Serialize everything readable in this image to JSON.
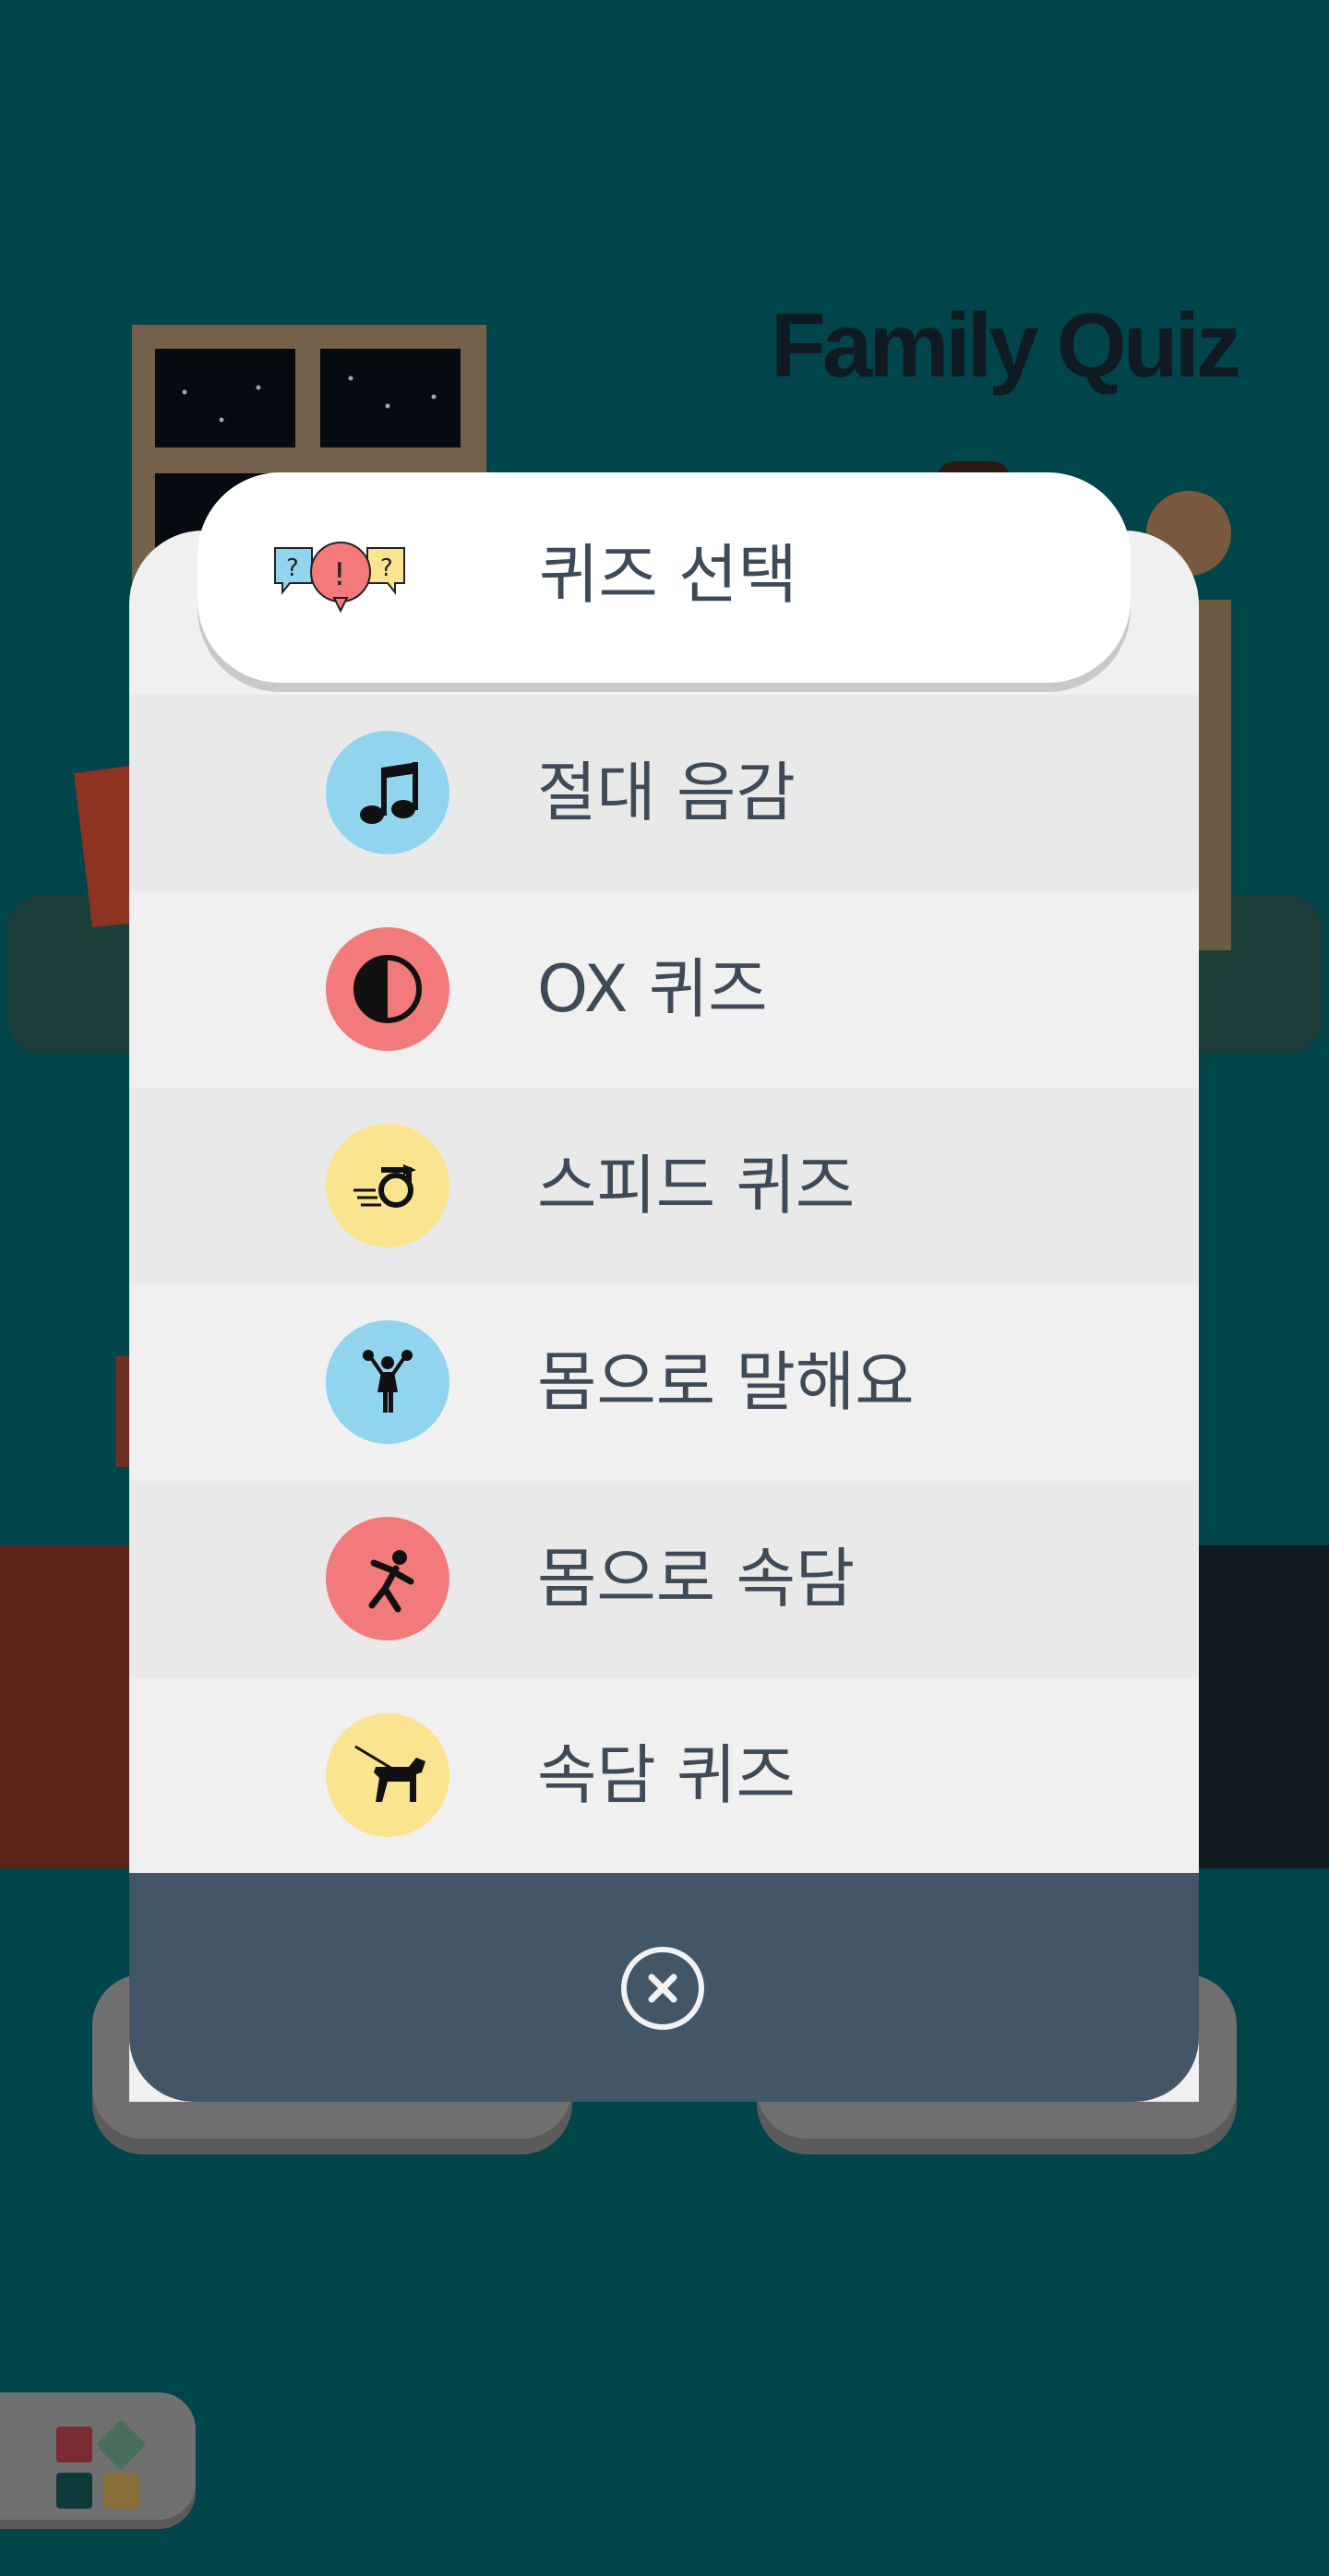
{
  "app": {
    "title": "Family Quiz"
  },
  "modal": {
    "title": "퀴즈 선택",
    "items": [
      {
        "label": "절대 음감",
        "icon": "music-note-icon",
        "color": "#91d4ee"
      },
      {
        "label": "OX 퀴즈",
        "icon": "half-circle-icon",
        "color": "#f27a7a"
      },
      {
        "label": "스피드 퀴즈",
        "icon": "speed-hand-icon",
        "color": "#fbe48f"
      },
      {
        "label": "몸으로 말해요",
        "icon": "cheerleader-icon",
        "color": "#91d4ee"
      },
      {
        "label": "몸으로 속담",
        "icon": "dancer-icon",
        "color": "#f27a7a"
      },
      {
        "label": "속담 퀴즈",
        "icon": "dog-walking-icon",
        "color": "#fbe48f"
      }
    ],
    "close_icon": "close-circle-icon"
  },
  "colors": {
    "background": "#00454a",
    "modal_body": "#f0f0f0",
    "modal_footer": "#435665",
    "text": "#3e4a58"
  }
}
